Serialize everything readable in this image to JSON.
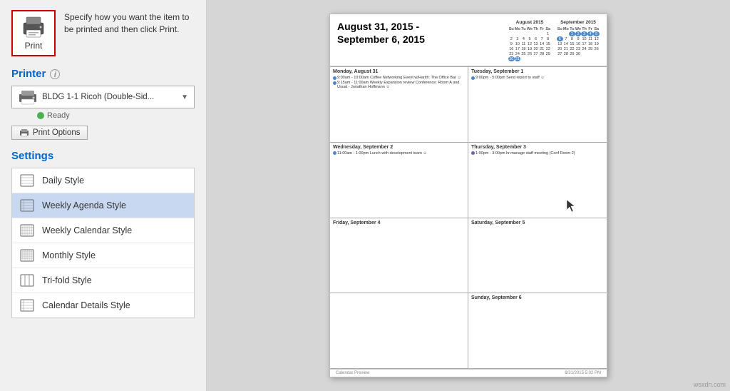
{
  "print_button": {
    "label": "Print",
    "description": "Specify how you want the item to be printed and then click Print."
  },
  "printer_section": {
    "title": "Printer",
    "name": "BLDG 1-1 Ricoh (Double-Sid...",
    "status": "Ready",
    "options_button": "Print Options"
  },
  "settings_section": {
    "title": "Settings",
    "styles": [
      {
        "id": "daily",
        "label": "Daily Style",
        "selected": false
      },
      {
        "id": "weekly-agenda",
        "label": "Weekly Agenda Style",
        "selected": true
      },
      {
        "id": "weekly-calendar",
        "label": "Weekly Calendar Style",
        "selected": false
      },
      {
        "id": "monthly",
        "label": "Monthly Style",
        "selected": false
      },
      {
        "id": "trifold",
        "label": "Tri-fold Style",
        "selected": false
      },
      {
        "id": "calendar-details",
        "label": "Calendar Details Style",
        "selected": false
      }
    ]
  },
  "calendar_preview": {
    "title_line1": "August 31, 2015 -",
    "title_line2": "September 6, 2015",
    "mini_cal_august": {
      "title": "August 2015",
      "headers": [
        "Su",
        "Mo",
        "Tu",
        "We",
        "Th",
        "Fr",
        "Sa"
      ],
      "rows": [
        [
          "",
          "",
          "",
          "",
          "",
          "",
          "1"
        ],
        [
          "2",
          "3",
          "4",
          "5",
          "6",
          "7",
          "8"
        ],
        [
          "9",
          "10",
          "11",
          "12",
          "13",
          "14",
          "15"
        ],
        [
          "16",
          "17",
          "18",
          "19",
          "20",
          "21",
          "22"
        ],
        [
          "23",
          "24",
          "25",
          "26",
          "27",
          "28",
          "29"
        ],
        [
          "30",
          "31",
          "",
          "",
          "",
          "",
          ""
        ]
      ]
    },
    "mini_cal_september": {
      "title": "September 2015",
      "headers": [
        "Su",
        "Mo",
        "Tu",
        "We",
        "Th",
        "Fr",
        "Sa"
      ],
      "rows": [
        [
          "",
          "",
          "1",
          "2",
          "3",
          "4",
          "5"
        ],
        [
          "6",
          "7",
          "8",
          "9",
          "10",
          "11",
          "12"
        ],
        [
          "13",
          "14",
          "15",
          "16",
          "17",
          "18",
          "19"
        ],
        [
          "20",
          "21",
          "22",
          "23",
          "24",
          "25",
          "26"
        ],
        [
          "27",
          "28",
          "29",
          "30",
          "",
          "",
          ""
        ]
      ]
    },
    "days": [
      {
        "name": "Monday, August 31",
        "events": [
          {
            "color": "blue",
            "text": "9:00am - 10:00am Coffee Networking Event w/Harith: The Office Bar ☺"
          },
          {
            "color": "blue",
            "text": "9:15am - 11:00am Weekly Expansion review Conference: Room A and Usual - Jonathan Hoffmann ☺"
          }
        ]
      },
      {
        "name": "Tuesday, September 1",
        "events": [
          {
            "color": "blue",
            "text": "9:00am - 5:00pm Send report to staff ☺"
          }
        ]
      },
      {
        "name": "Wednesday, September 2",
        "events": [
          {
            "color": "blue",
            "text": "11:00am - 1:00pm Lunch with development team ☺"
          }
        ]
      },
      {
        "name": "Thursday, September 3",
        "events": [
          {
            "color": "purple",
            "text": "1:00pm - 3:00pm hr.manage staff meeting (Conf Room 2)"
          }
        ]
      },
      {
        "name": "Friday, September 4",
        "events": []
      },
      {
        "name": "Saturday, September 5",
        "events": []
      },
      {
        "name": "",
        "events": []
      },
      {
        "name": "Sunday, September 6",
        "events": []
      }
    ],
    "footer_left": "Calendar Preview",
    "footer_right": "8/31/2015 5:02 PM"
  },
  "watermark": "wsxdn.com"
}
